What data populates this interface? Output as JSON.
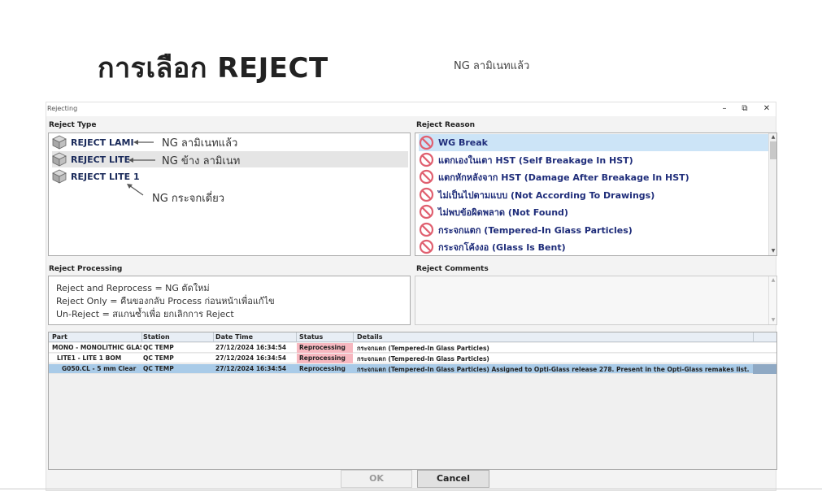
{
  "slide": {
    "title": "การเลือก  REJECT",
    "note": "NG ลามิเนทแล้ว"
  },
  "window": {
    "title": "Rejecting",
    "controls": [
      "–",
      "⧉",
      "✕"
    ]
  },
  "reject_type": {
    "label": "Reject Type",
    "items": [
      {
        "label": "REJECT LAMI",
        "icon": "cube-icon"
      },
      {
        "label": "REJECT LITE",
        "icon": "cube-icon",
        "selected": true
      },
      {
        "label": "REJECT LITE 1",
        "icon": "cube-icon"
      }
    ]
  },
  "annotations": [
    "NG ลามิเนทแล้ว",
    "NG ข้าง ลามิเนท",
    "NG กระจกเดี่ยว"
  ],
  "reject_reason": {
    "label": "Reject Reason",
    "items": [
      "WG Break",
      "แตกเองในเตา HST (Self Breakage In HST)",
      "แตกหักหลังจาก HST (Damage After Breakage In HST)",
      "ไม่เป็นไปตามแบบ (Not According To Drawings)",
      "ไม่พบข้อผิดพลาด (Not Found)",
      "กระจกแตก (Tempered-In Glass Particles)",
      "กระจกโค้งงอ (Glass Is Bent)"
    ],
    "icon": "prohibited-icon"
  },
  "reject_processing": {
    "label": "Reject Processing",
    "lines": [
      "Reject and Reprocess  =  NG ตัดใหม่",
      "Reject Only              =  คืนของกลับ Process ก่อนหน้าเพื่อแก้ไข",
      "Un-Reject                 =  สแกนซ้ำเพื่อ ยกเลิกการ Reject"
    ]
  },
  "reject_comments": {
    "label": "Reject Comments",
    "value": ""
  },
  "grid": {
    "columns": [
      "Part",
      "Station",
      "Date Time",
      "Status",
      "Details"
    ],
    "rows": [
      {
        "part": "MONO - MONOLITHIC GLASS",
        "station": "QC TEMP",
        "datetime": "27/12/2024 16:34:54",
        "status": "Reprocessing",
        "details": "กระจกแตก (Tempered-In Glass Particles)"
      },
      {
        "part": "LITE1 - LITE 1 BOM",
        "station": "QC TEMP",
        "datetime": "27/12/2024 16:34:54",
        "status": "Reprocessing",
        "details": "กระจกแตก (Tempered-In Glass Particles)"
      },
      {
        "part": "G050.CL - 5 mm Clear",
        "station": "QC TEMP",
        "datetime": "27/12/2024 16:34:54",
        "status": "Reprocessing",
        "details": "กระจกแตก (Tempered-In Glass Particles)  Assigned to Opti-Glass release 278.  Present in the Opti-Glass remakes list."
      }
    ]
  },
  "buttons": {
    "ok": "OK",
    "cancel": "Cancel"
  },
  "colors": {
    "selected_row": "#a9cbe8",
    "status_pink": "#f7b8c0",
    "reason_text": "#1f2d7a",
    "prohibited_red": "#e06070"
  }
}
